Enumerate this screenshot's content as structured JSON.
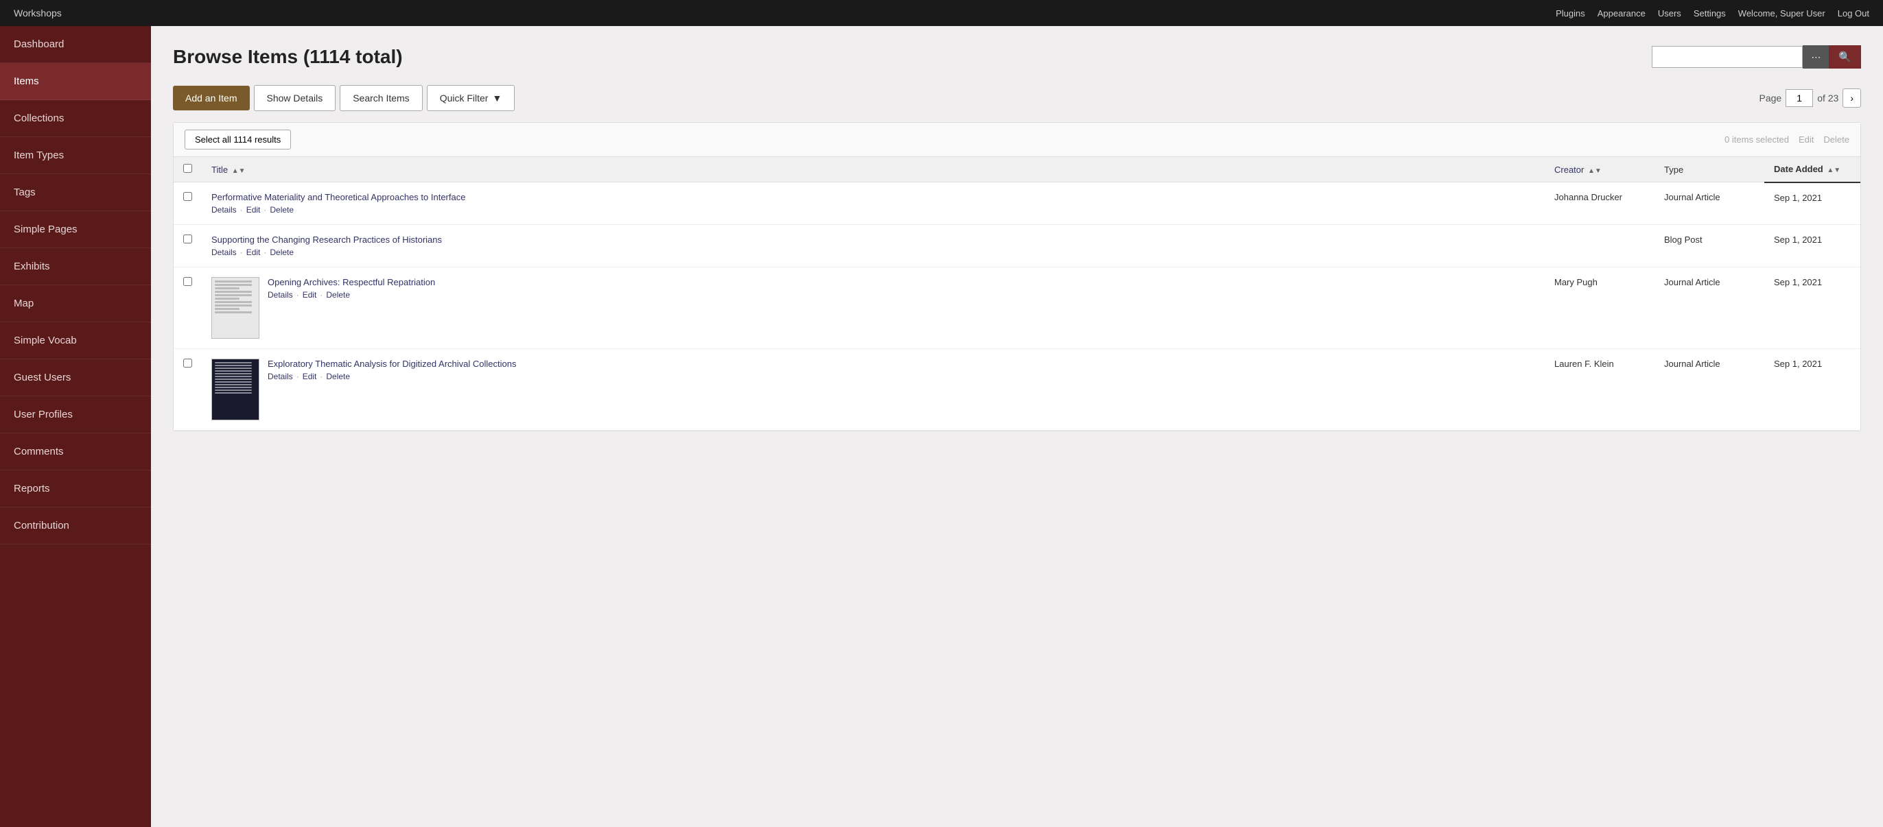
{
  "topnav": {
    "brand": "Workshops",
    "links": [
      "Plugins",
      "Appearance",
      "Users",
      "Settings"
    ],
    "welcome_label": "Welcome,",
    "welcome_user": "Super User",
    "logout": "Log Out"
  },
  "sidebar": {
    "items": [
      {
        "id": "dashboard",
        "label": "Dashboard",
        "active": false
      },
      {
        "id": "items",
        "label": "Items",
        "active": true
      },
      {
        "id": "collections",
        "label": "Collections",
        "active": false
      },
      {
        "id": "item-types",
        "label": "Item Types",
        "active": false
      },
      {
        "id": "tags",
        "label": "Tags",
        "active": false
      },
      {
        "id": "simple-pages",
        "label": "Simple Pages",
        "active": false
      },
      {
        "id": "exhibits",
        "label": "Exhibits",
        "active": false
      },
      {
        "id": "map",
        "label": "Map",
        "active": false
      },
      {
        "id": "simple-vocab",
        "label": "Simple Vocab",
        "active": false
      },
      {
        "id": "guest-users",
        "label": "Guest Users",
        "active": false
      },
      {
        "id": "user-profiles",
        "label": "User Profiles",
        "active": false
      },
      {
        "id": "comments",
        "label": "Comments",
        "active": false
      },
      {
        "id": "reports",
        "label": "Reports",
        "active": false
      },
      {
        "id": "contribution",
        "label": "Contribution",
        "active": false
      }
    ]
  },
  "main": {
    "title": "Browse Items (1114 total)",
    "search_placeholder": "",
    "toolbar": {
      "add_label": "Add an Item",
      "show_details_label": "Show Details",
      "search_items_label": "Search Items",
      "quick_filter_label": "Quick Filter"
    },
    "pagination": {
      "page_label": "Page",
      "current_page": "1",
      "total_pages": "of 23"
    },
    "select_all_label": "Select all 1114 results",
    "items_selected": "0 items selected",
    "edit_label": "Edit",
    "delete_label": "Delete",
    "columns": {
      "title": "Title",
      "creator": "Creator",
      "type": "Type",
      "date_added": "Date Added"
    },
    "rows": [
      {
        "id": 1,
        "title": "Performative Materiality and Theoretical Approaches to Interface",
        "creator": "Johanna Drucker",
        "type": "Journal Article",
        "date_added": "Sep 1, 2021",
        "has_thumb": false
      },
      {
        "id": 2,
        "title": "Supporting the Changing Research Practices of Historians",
        "creator": "",
        "type": "Blog Post",
        "date_added": "Sep 1, 2021",
        "has_thumb": false
      },
      {
        "id": 3,
        "title": "Opening Archives: Respectful Repatriation",
        "creator": "Mary Pugh",
        "type": "Journal Article",
        "date_added": "Sep 1, 2021",
        "has_thumb": true,
        "thumb_style": "paper"
      },
      {
        "id": 4,
        "title": "Exploratory Thematic Analysis for Digitized Archival Collections",
        "creator": "Lauren F. Klein",
        "type": "Journal Article",
        "date_added": "Sep 1, 2021",
        "has_thumb": true,
        "thumb_style": "dark"
      }
    ]
  }
}
